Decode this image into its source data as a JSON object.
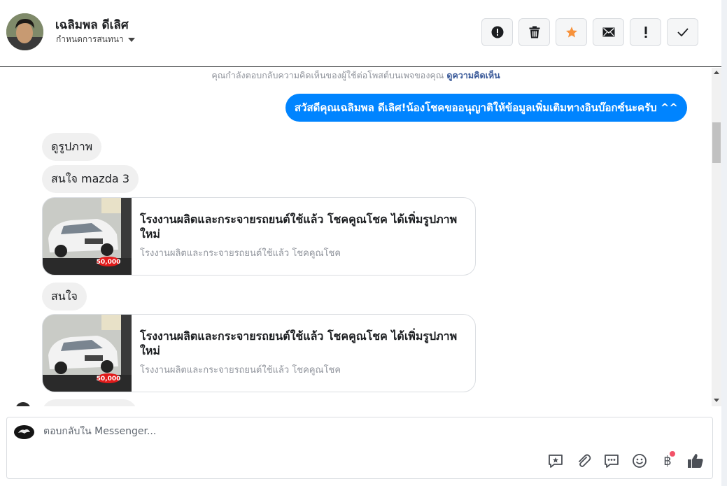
{
  "header": {
    "contact_name": "เฉลิมพล ดีเลิศ",
    "conversation_settings": "กำหนดการสนทนา",
    "toolbar": [
      {
        "name": "report-spam-button",
        "icon": "exclamation-circle-icon"
      },
      {
        "name": "delete-button",
        "icon": "trash-icon"
      },
      {
        "name": "star-button",
        "icon": "star-icon",
        "color": "#f7923b"
      },
      {
        "name": "mark-unread-button",
        "icon": "envelope-icon"
      },
      {
        "name": "flag-important-button",
        "icon": "exclamation-icon"
      },
      {
        "name": "mark-done-button",
        "icon": "check-icon"
      }
    ]
  },
  "notice": {
    "text": "คุณกำลังตอบกลับความคิดเห็นของผู้ใช้ต่อโพสต์บนเพจของคุณ",
    "link": "ดูความคิดเห็น"
  },
  "messages": {
    "outgoing": "สวัสดีคุณเฉลิมพล ดีเลิศ!น้องโชคขออนุญาติให้ข้อมูลเพิ่มเติมทางอินบ๊อกซ์นะครับ ^^",
    "incoming_1": "ดูรูปภาพ",
    "incoming_2": "สนใจ mazda 3",
    "card_1": {
      "title": "โรงงานผลิตและกระจายรถยนต์ใช้แล้ว โชคคูณโชค ได้เพิ่มรูปภาพใหม่",
      "subtitle": "โรงงานผลิตและกระจายรถยนต์ใช้แล้ว โชคคูณโชค",
      "price_tag": "50,000"
    },
    "incoming_3": "สนใจ",
    "card_2": {
      "title": "โรงงานผลิตและกระจายรถยนต์ใช้แล้ว โชคคูณโชค ได้เพิ่มรูปภาพใหม่",
      "subtitle": "โรงงานผลิตและกระจายรถยนต์ใช้แล้ว โชคคูณโชค",
      "price_tag": "50,000"
    }
  },
  "composer": {
    "placeholder": "ตอบกลับใน Messenger...",
    "tools": [
      "saved-reply-icon",
      "attachment-icon",
      "quick-replies-icon",
      "emoji-icon",
      "payment-icon",
      "like-icon"
    ],
    "payment_symbol": "฿",
    "accent": "#4b4f56",
    "notification_color": "#f25268"
  },
  "colors": {
    "outgoing_bubble": "#0084ff",
    "incoming_bubble": "#f0f0f0",
    "link": "#385898"
  }
}
